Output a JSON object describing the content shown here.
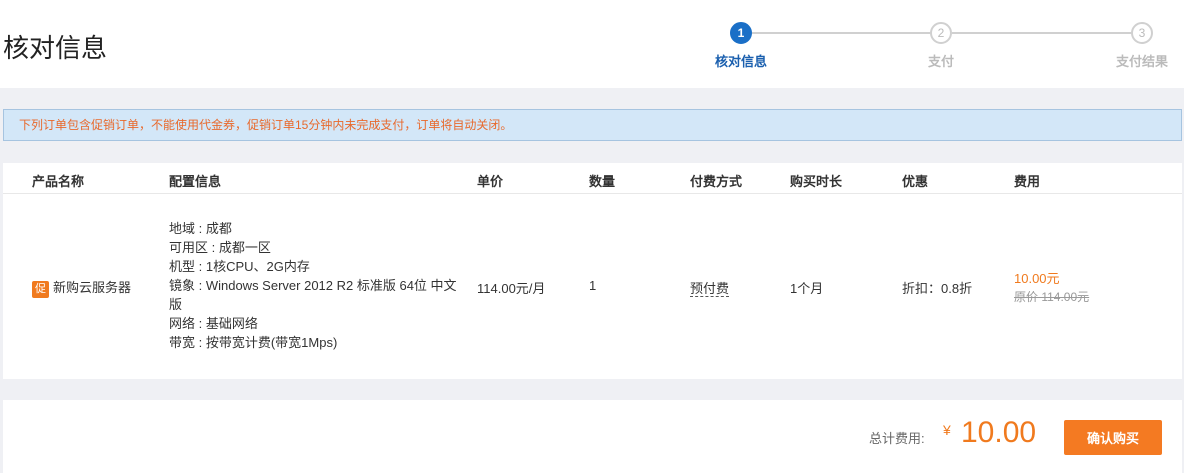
{
  "header": {
    "title": "核对信息",
    "steps": [
      {
        "num": "1",
        "label": "核对信息"
      },
      {
        "num": "2",
        "label": "支付"
      },
      {
        "num": "3",
        "label": "支付结果"
      }
    ]
  },
  "notice": "下列订单包含促销订单，不能使用代金券，促销订单15分钟内未完成支付，订单将自动关闭。",
  "table": {
    "columns": [
      "产品名称",
      "配置信息",
      "单价",
      "数量",
      "付费方式",
      "购买时长",
      "优惠",
      "费用"
    ],
    "row": {
      "promo_badge": "促",
      "product": "新购云服务器",
      "config": [
        "地域 : 成都",
        "可用区 : 成都一区",
        "机型 : 1核CPU、2G内存",
        "镜象 : Windows Server 2012 R2 标准版 64位 中文版",
        "网络 : 基础网络",
        "带宽 : 按带宽计费(带宽1Mps)"
      ],
      "unit_price": "114.00元/月",
      "quantity": "1",
      "payment": "预付费",
      "duration": "1个月",
      "discount": "折扣：0.8折",
      "fee": "10.00元",
      "original": "原价 114.00元"
    }
  },
  "footer": {
    "total_label": "总计费用:",
    "currency": "¥",
    "total": "10.00",
    "confirm": "确认购买"
  }
}
